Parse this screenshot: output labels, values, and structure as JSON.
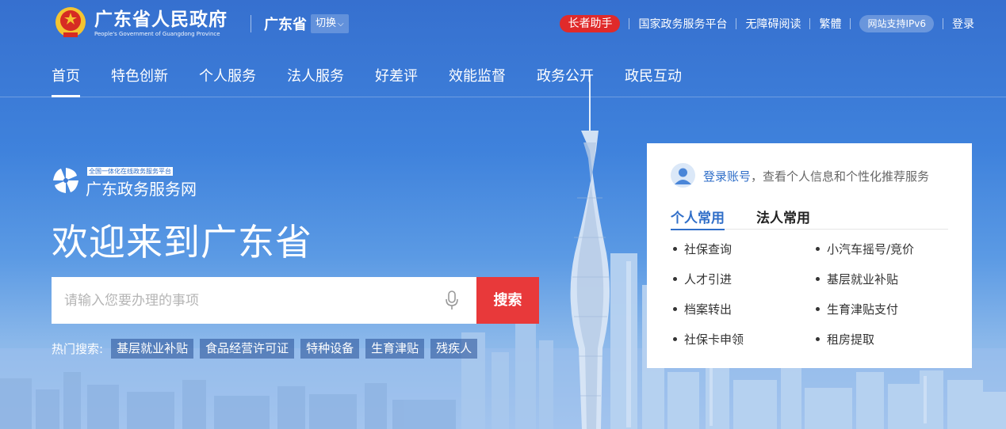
{
  "header": {
    "title": "广东省人民政府",
    "subtitle": "People's Government of Guangdong Province",
    "region": "广东省",
    "switch_label": "切换",
    "links": {
      "elder": "长者助手",
      "national": "国家政务服务平台",
      "accessible": "无障碍阅读",
      "traditional": "繁體",
      "ipv6": "网站支持IPv6",
      "login": "登录"
    }
  },
  "nav": {
    "items": [
      {
        "label": "首页"
      },
      {
        "label": "特色创新"
      },
      {
        "label": "个人服务"
      },
      {
        "label": "法人服务"
      },
      {
        "label": "好差评"
      },
      {
        "label": "效能监督"
      },
      {
        "label": "政务公开"
      },
      {
        "label": "政民互动"
      }
    ]
  },
  "brand": {
    "tagline": "全国一体化在线政务服务平台",
    "name": "广东政务服务网"
  },
  "hero": {
    "welcome": "欢迎来到广东省"
  },
  "search": {
    "placeholder": "请输入您要办理的事项",
    "button": "搜索",
    "hot_label": "热门搜索:",
    "hot_tags": [
      "基层就业补贴",
      "食品经营许可证",
      "特种设备",
      "生育津贴",
      "残疾人"
    ]
  },
  "panel": {
    "login_link": "登录账号",
    "login_text": "，查看个人信息和个性化推荐服务",
    "tabs": [
      "个人常用",
      "法人常用"
    ],
    "services": [
      "社保查询",
      "小汽车摇号/竞价",
      "人才引进",
      "基层就业补贴",
      "档案转出",
      "生育津贴支付",
      "社保卡申领",
      "租房提取"
    ]
  },
  "colors": {
    "primary_blue": "#3a79d6",
    "accent_red": "#e8393a",
    "link_blue": "#2f6ec8"
  },
  "icons": {
    "emblem": "national-emblem-icon",
    "mic": "microphone-icon",
    "avatar": "user-avatar-icon",
    "brand_logo": "pinwheel-logo-icon"
  }
}
